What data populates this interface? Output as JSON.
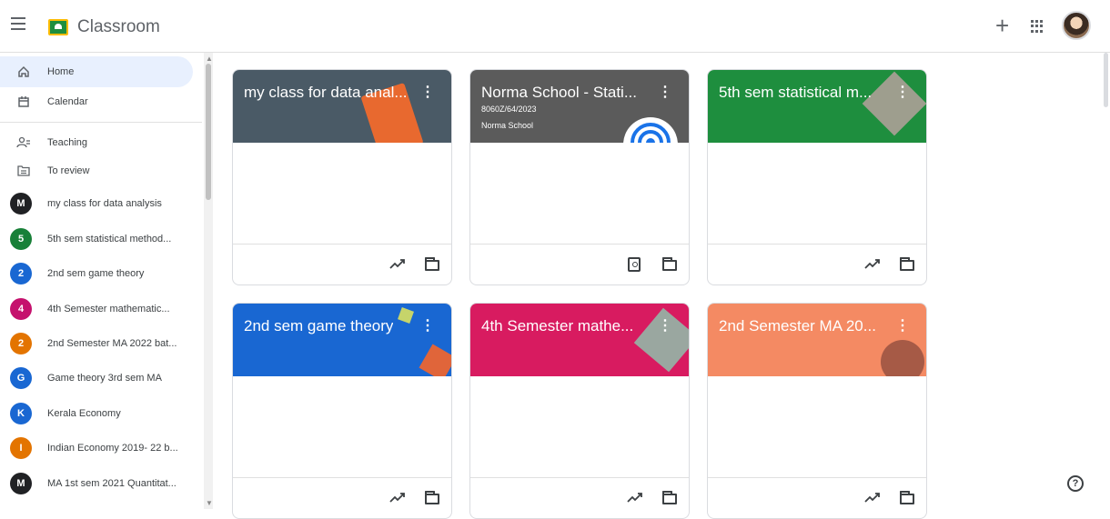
{
  "header": {
    "app_title": "Classroom",
    "icons": {
      "menu": "hamburger-menu-icon",
      "logo": "classroom-logo-icon",
      "create": "plus-icon",
      "apps": "apps-grid-icon",
      "account": "avatar"
    }
  },
  "sidebar": {
    "primary": [
      {
        "label": "Home",
        "icon": "home-icon",
        "active": true
      },
      {
        "label": "Calendar",
        "icon": "calendar-icon",
        "active": false
      }
    ],
    "secondary": [
      {
        "label": "Teaching",
        "icon": "people-icon"
      },
      {
        "label": "To review",
        "icon": "folder-review-icon"
      }
    ],
    "classes": [
      {
        "initial": "M",
        "label": "my class for data analysis",
        "color": "#202124"
      },
      {
        "initial": "5",
        "label": "5th sem statistical method...",
        "color": "#188038"
      },
      {
        "initial": "2",
        "label": "2nd sem game theory",
        "color": "#1967d2"
      },
      {
        "initial": "4",
        "label": "4th Semester mathematic...",
        "color": "#c5116d"
      },
      {
        "initial": "2",
        "label": "2nd Semester MA 2022 bat...",
        "color": "#e37400"
      },
      {
        "initial": "G",
        "label": "Game theory 3rd sem MA",
        "color": "#1967d2"
      },
      {
        "initial": "K",
        "label": "Kerala Economy",
        "color": "#1967d2"
      },
      {
        "initial": "I",
        "label": "Indian Economy 2019- 22 b...",
        "color": "#e37400"
      },
      {
        "initial": "M",
        "label": "MA 1st sem 2021 Quantitat...",
        "color": "#202124"
      }
    ]
  },
  "cards": [
    {
      "title": "my class for data anal...",
      "subtitle": "",
      "subtitle2": "",
      "color": "#4a5a66",
      "footer_icons": [
        "trending-icon",
        "folder-icon"
      ]
    },
    {
      "title": "Norma School - Stati...",
      "subtitle": "8060Z/64/2023",
      "subtitle2": "Norma School",
      "color": "#5b5b5b",
      "footer_icons": [
        "portrait-icon",
        "folder-icon"
      ]
    },
    {
      "title": "5th sem statistical m...",
      "subtitle": "",
      "subtitle2": "",
      "color": "#1e8e3e",
      "footer_icons": [
        "trending-icon",
        "folder-icon"
      ]
    },
    {
      "title": "2nd sem game theory",
      "subtitle": "",
      "subtitle2": "",
      "color": "#1967d2",
      "footer_icons": [
        "trending-icon",
        "folder-icon"
      ]
    },
    {
      "title": "4th Semester mathe...",
      "subtitle": "",
      "subtitle2": "",
      "color": "#d81b60",
      "footer_icons": [
        "trending-icon",
        "folder-icon"
      ]
    },
    {
      "title": "2nd Semester MA 20...",
      "subtitle": "",
      "subtitle2": "",
      "color": "#f48a63",
      "footer_icons": [
        "trending-icon",
        "folder-icon"
      ]
    }
  ],
  "help": {
    "label": "?"
  }
}
